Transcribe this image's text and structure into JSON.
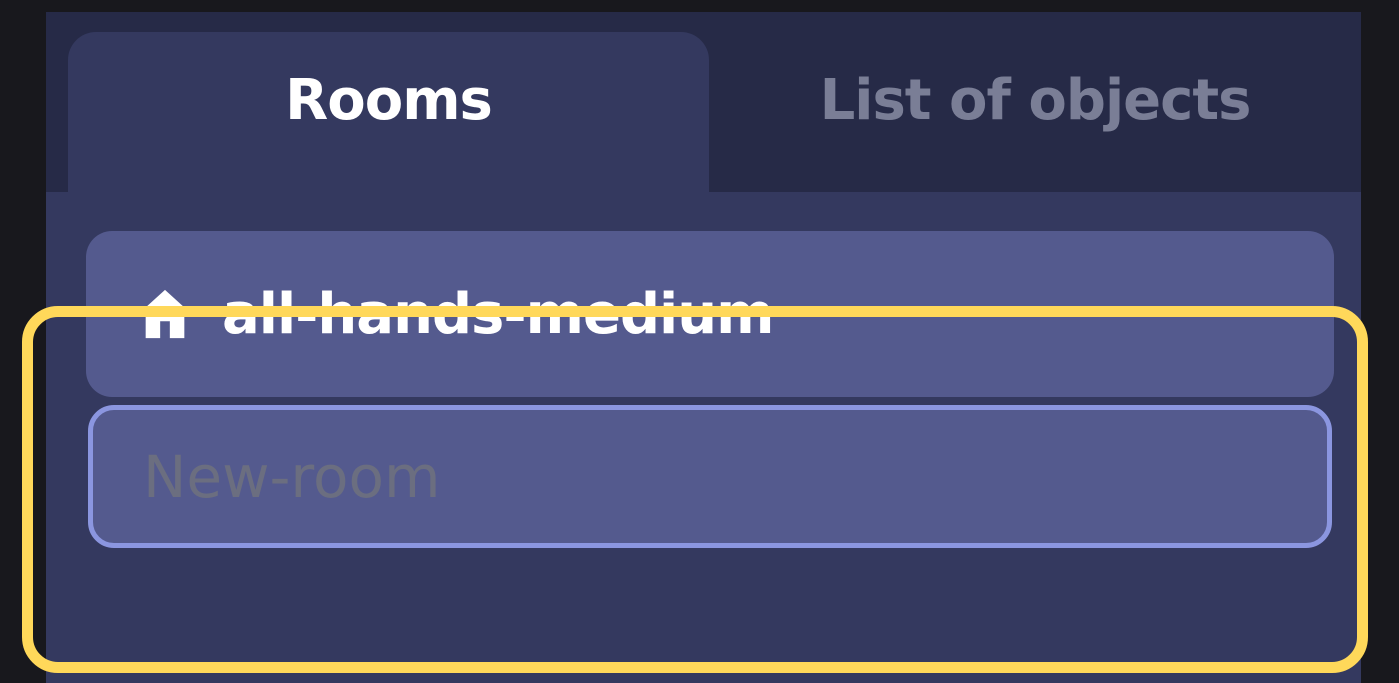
{
  "tabs": {
    "rooms_label": "Rooms",
    "objects_label": "List of objects",
    "active": "Rooms"
  },
  "rooms": [
    {
      "name": "all-hands-medium",
      "icon": "home-icon"
    }
  ],
  "new_room_input": {
    "placeholder": "New-room",
    "value": ""
  },
  "colors": {
    "panel_bg": "#34395f",
    "tabbar_bg": "#262a47",
    "card_bg": "#545a8e",
    "input_border": "#8b96e0",
    "highlight": "#ffd85a"
  }
}
